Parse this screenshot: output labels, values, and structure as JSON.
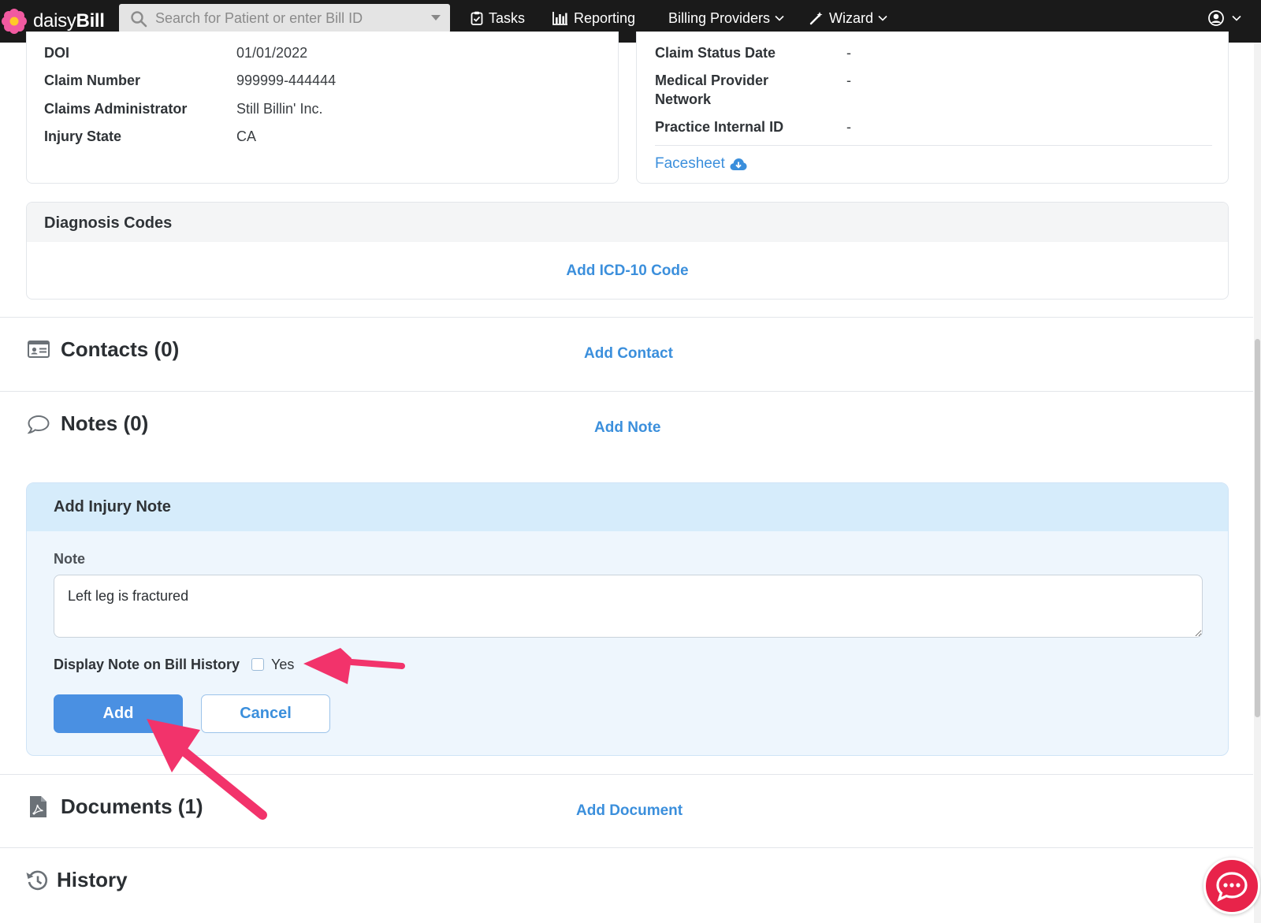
{
  "brand": {
    "name_light": "daisy",
    "name_bold": "Bill",
    "accent": "#e8234a"
  },
  "search": {
    "placeholder": "Search for Patient or enter Bill ID"
  },
  "nav": {
    "tasks": "Tasks",
    "reporting": "Reporting",
    "billing_providers": "Billing Providers",
    "wizard": "Wizard"
  },
  "claim_left": [
    {
      "label": "DOI",
      "value": "01/01/2022"
    },
    {
      "label": "Claim Number",
      "value": "999999-444444"
    },
    {
      "label": "Claims Administrator",
      "value": "Still Billin' Inc."
    },
    {
      "label": "Injury State",
      "value": "CA"
    }
  ],
  "claim_right": {
    "status_date_label": "Claim Status Date",
    "status_date_value": "-",
    "mpn_label_line1": "Medical Provider",
    "mpn_label_line2": "Network",
    "mpn_value": "-",
    "internal_id_label": "Practice Internal ID",
    "internal_id_value": "-",
    "facesheet_link": "Facesheet"
  },
  "diagnosis": {
    "title": "Diagnosis Codes",
    "add_link": "Add ICD-10 Code"
  },
  "contacts": {
    "title": "Contacts (0)",
    "add_link": "Add Contact"
  },
  "notes": {
    "title": "Notes (0)",
    "add_link": "Add Note"
  },
  "note_form": {
    "title": "Add Injury Note",
    "note_label": "Note",
    "note_value": "Left leg is fractured",
    "display_label": "Display Note on Bill History",
    "yes_label": "Yes",
    "add_button": "Add",
    "cancel_button": "Cancel"
  },
  "documents": {
    "title": "Documents (1)",
    "add_link": "Add Document"
  },
  "history": {
    "title": "History"
  },
  "colors": {
    "link": "#3b8fdc",
    "primary_button": "#4a90e2",
    "annotation_arrow": "#f2336b"
  }
}
